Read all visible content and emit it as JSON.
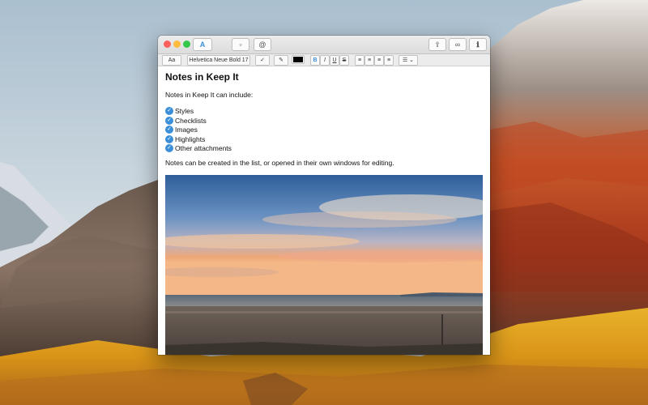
{
  "window": {
    "toolbar_icons": [
      "format-text-icon",
      "attachment-icon",
      "mention-icon",
      "share-icon",
      "link-icon",
      "info-icon"
    ],
    "format_bar": {
      "style_menu": "Aa",
      "font_menu": "Helvetica Neue Bold 17",
      "bold": "B",
      "italic": "I",
      "underline": "U",
      "strikethrough": "S",
      "text_color": "#000000"
    }
  },
  "note": {
    "title": "Notes in Keep It",
    "intro": "Notes in Keep It can include:",
    "checklist": [
      "Styles",
      "Checklists",
      "Images",
      "Highlights",
      "Other attachments"
    ],
    "footer_text": "Notes can be created in the list, or opened in their own windows for editing."
  },
  "colors": {
    "accent": "#3a8fd8",
    "close": "#fc605b",
    "minimize": "#fdbc40",
    "zoom": "#34c84a"
  }
}
